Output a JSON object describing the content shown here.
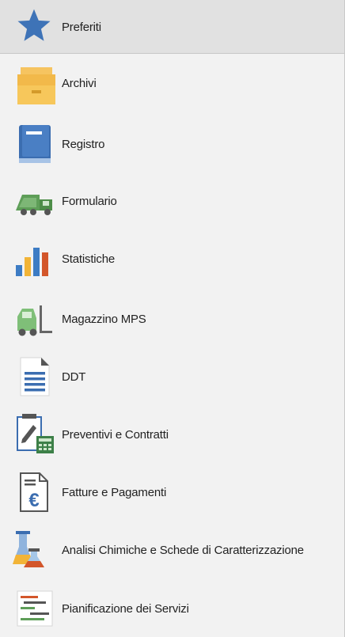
{
  "header": {
    "label": "Preferiti",
    "icon": "star-icon"
  },
  "items": [
    {
      "label": "Archivi",
      "icon": "folder-boxes-icon"
    },
    {
      "label": "Registro",
      "icon": "book-icon"
    },
    {
      "label": "Formulario",
      "icon": "truck-icon"
    },
    {
      "label": "Statistiche",
      "icon": "bar-chart-icon"
    },
    {
      "label": "Magazzino MPS",
      "icon": "forklift-icon"
    },
    {
      "label": "DDT",
      "icon": "document-icon"
    },
    {
      "label": "Preventivi e Contratti",
      "icon": "contract-calculator-icon"
    },
    {
      "label": "Fatture e Pagamenti",
      "icon": "euro-invoice-icon"
    },
    {
      "label": "Analisi Chimiche e Schede di Caratterizzazione",
      "icon": "lab-flask-icon"
    },
    {
      "label": "Pianificazione dei Servizi",
      "icon": "gantt-plan-icon"
    }
  ],
  "colors": {
    "header_bg": "#e1e1e1",
    "panel_bg": "#f2f2f2",
    "star": "#3e73b7"
  }
}
